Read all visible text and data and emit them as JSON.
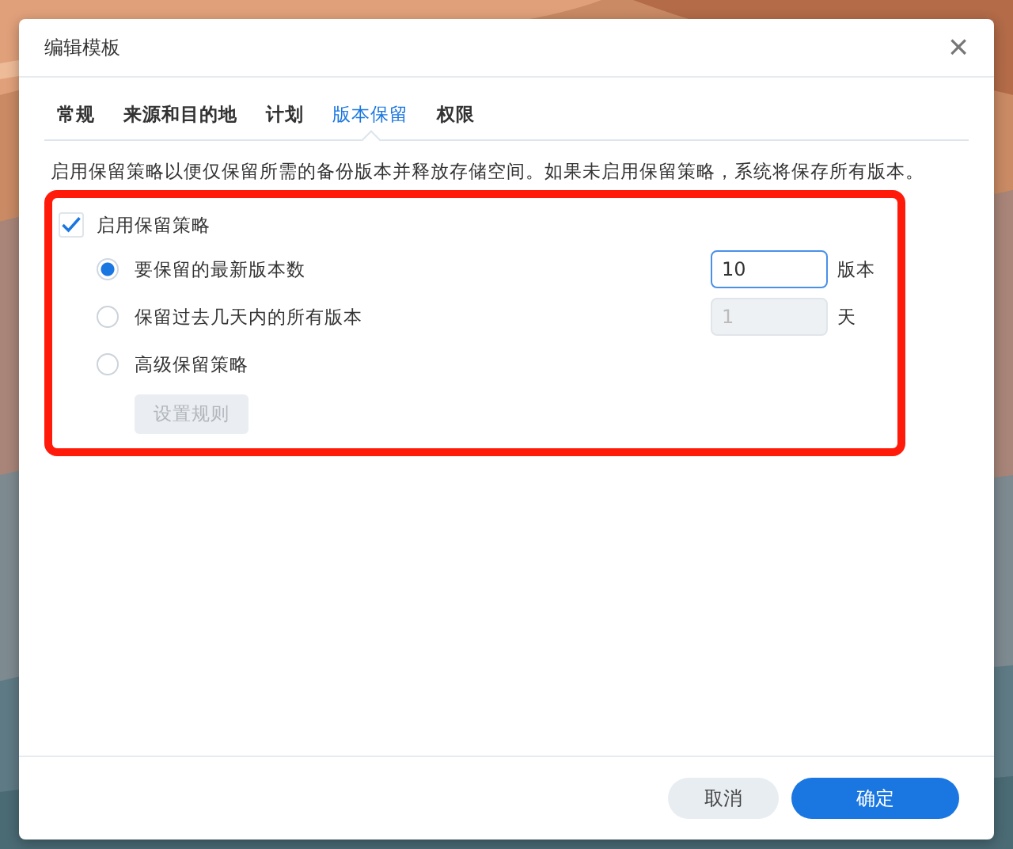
{
  "window": {
    "title": "编辑模板",
    "close": "×"
  },
  "tabs": [
    {
      "label": "常规",
      "selected": false
    },
    {
      "label": "来源和目的地",
      "selected": false
    },
    {
      "label": "计划",
      "selected": false
    },
    {
      "label": "版本保留",
      "selected": true
    },
    {
      "label": "权限",
      "selected": false
    }
  ],
  "description": "启用保留策略以便仅保留所需的备份版本并释放存储空间。如果未启用保留策略，系统将保存所有版本。",
  "enable_policy": {
    "label": "启用保留策略",
    "checked": true
  },
  "options": [
    {
      "label": "要保留的最新版本数",
      "selected": true,
      "field": {
        "value": "10",
        "unit": "版本",
        "disabled": false,
        "focused": true
      }
    },
    {
      "label": "保留过去几天内的所有版本",
      "selected": false,
      "field": {
        "value": "1",
        "unit": "天",
        "disabled": true,
        "focused": false
      }
    },
    {
      "label": "高级保留策略",
      "selected": false
    }
  ],
  "rule_button": {
    "label": "设置规则",
    "disabled": true
  },
  "buttons": [
    {
      "label": "取消",
      "kind": "secondary"
    },
    {
      "label": "确定",
      "kind": "primary"
    }
  ]
}
